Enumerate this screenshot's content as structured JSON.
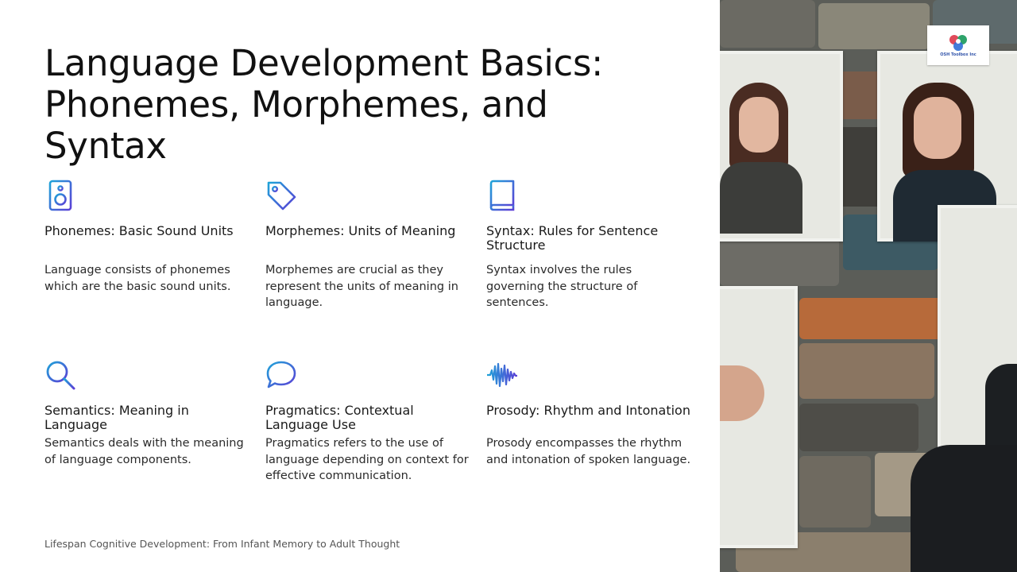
{
  "title": "Language Development Basics: Phonemes, Morphemes, and Syntax",
  "cards": [
    {
      "icon": "speaker-icon",
      "heading": "Phonemes: Basic Sound Units",
      "body": "Language consists of phonemes which are the basic sound units."
    },
    {
      "icon": "tag-icon",
      "heading": "Morphemes: Units of Meaning",
      "body": "Morphemes are crucial as they represent the units of meaning in language."
    },
    {
      "icon": "book-icon",
      "heading": "Syntax: Rules for Sentence Structure",
      "body": "Syntax involves the rules governing the structure of sentences."
    },
    {
      "icon": "magnifier-icon",
      "heading": "Semantics: Meaning in Language",
      "body": "Semantics deals with the meaning of language components."
    },
    {
      "icon": "speech-bubble-icon",
      "heading": "Pragmatics: Contextual Language Use",
      "body": "Pragmatics refers to the use of language depending on context for effective communication."
    },
    {
      "icon": "soundwave-icon",
      "heading": "Prosody: Rhythm and Intonation",
      "body": "Prosody encompasses the rhythm and intonation of spoken language."
    }
  ],
  "footer": "Lifespan Cognitive Development: From Infant Memory to Adult Thought",
  "logo": {
    "text": "OSH Toolbox Inc"
  },
  "colors": {
    "icon_gradient_start": "#1fa3d8",
    "icon_gradient_end": "#5b3fd6",
    "title": "#111111",
    "footer": "#555555"
  }
}
